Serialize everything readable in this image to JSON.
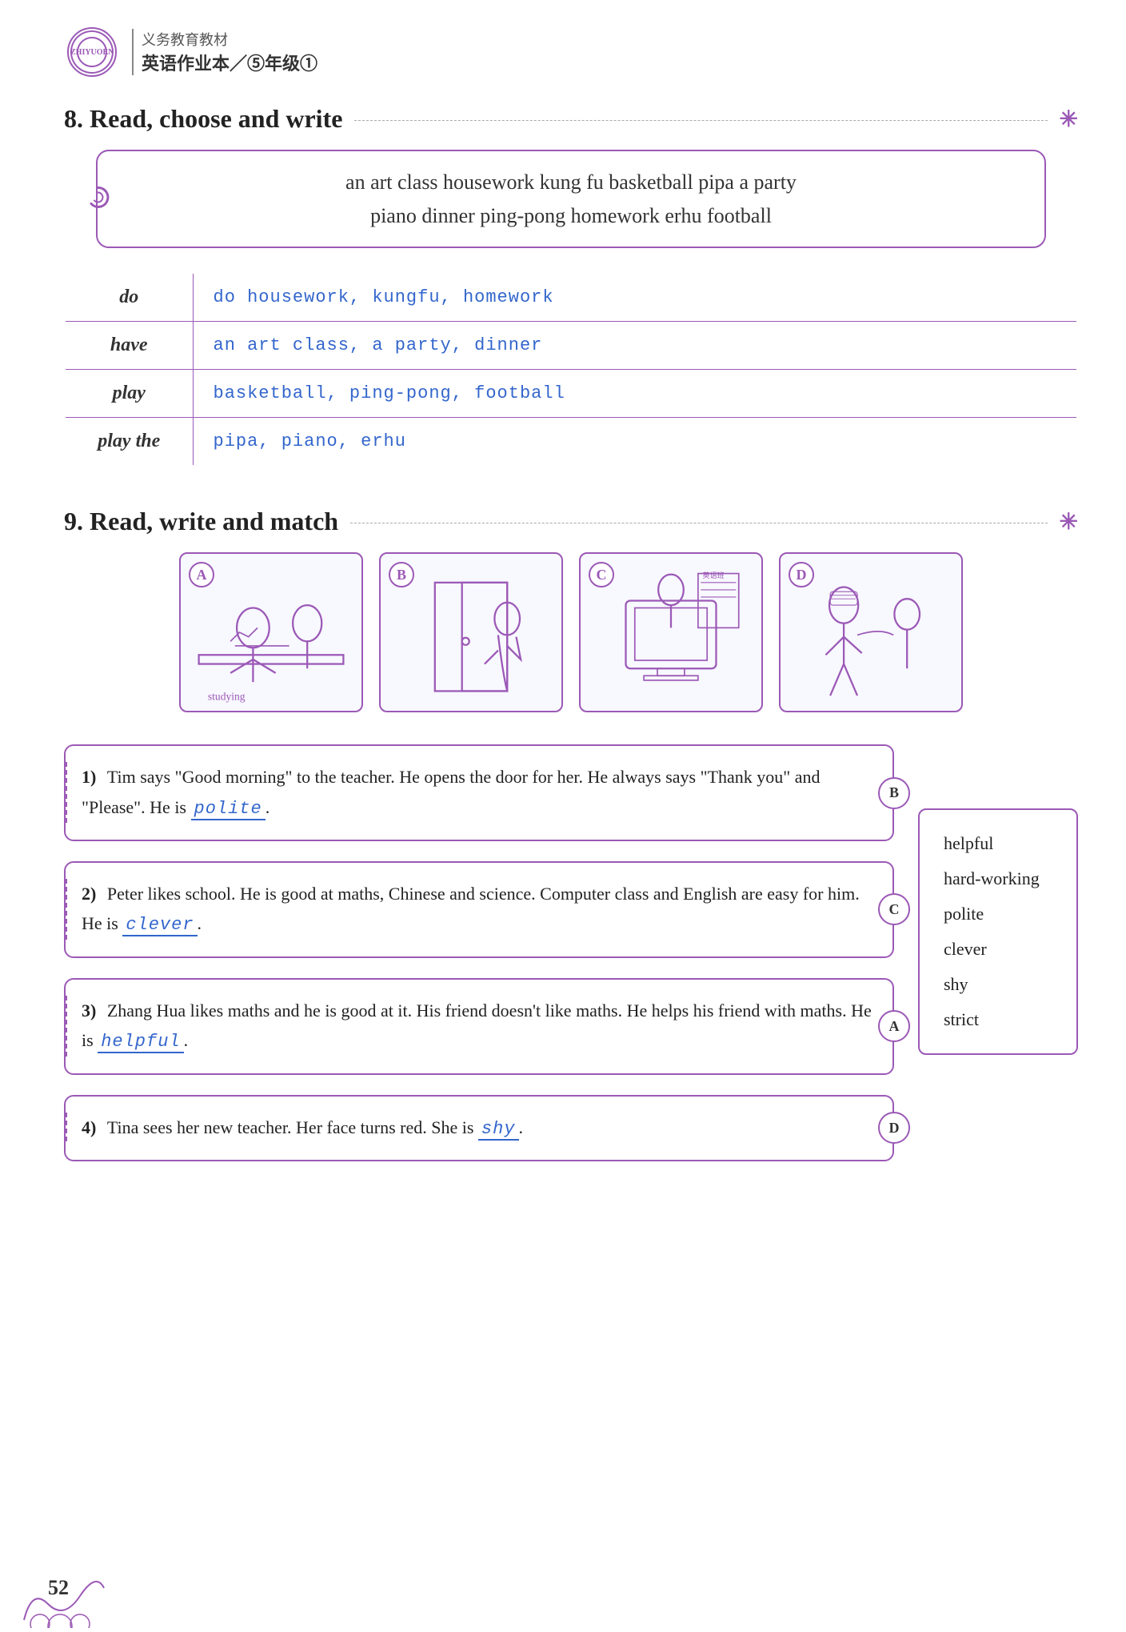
{
  "header": {
    "subtitle": "义务教育教材",
    "title": "英语作业本／⑤年级①"
  },
  "section8": {
    "heading_num": "8.",
    "heading_text": "Read, choose and write",
    "word_bank_line1": "an art class   housework   kung fu   basketball   pipa   a party",
    "word_bank_line2": "piano   dinner   ping-pong   homework   erhu   football",
    "table_rows": [
      {
        "verb": "do",
        "answers": "do housework,  kungfu,  homework"
      },
      {
        "verb": "have",
        "answers": "an art class,  a party,  dinner"
      },
      {
        "verb": "play",
        "answers": "basketball,  ping-pong,  football"
      },
      {
        "verb": "play the",
        "answers": "pipa,  piano,  erhu"
      }
    ]
  },
  "section9": {
    "heading_num": "9.",
    "heading_text": "Read, write and match",
    "images": [
      {
        "label": "A",
        "desc": "Two students studying at desk"
      },
      {
        "label": "B",
        "desc": "Girl opening door"
      },
      {
        "label": "C",
        "desc": "Student at computer with board"
      },
      {
        "label": "D",
        "desc": "Teacher talking to student"
      }
    ],
    "sentences": [
      {
        "num": "1)",
        "text_before": "Tim says \"Good morning\" to the teacher. He opens the door for her. He always says \"Thank you\" and \"Please\". He is",
        "answer": "polite",
        "text_after": ".",
        "circle_label": "B"
      },
      {
        "num": "2)",
        "text_before": "Peter likes school. He is good at maths, Chinese and science. Computer class and English are easy for him. He is",
        "answer": "clever",
        "text_after": ".",
        "circle_label": "C"
      },
      {
        "num": "3)",
        "text_before": "Zhang Hua likes maths and he is good at it. His friend doesn't like maths. He helps his friend with maths. He is",
        "answer": "helpful",
        "text_after": ".",
        "circle_label": "A"
      },
      {
        "num": "4)",
        "text_before": "Tina sees her new teacher. Her face turns red. She is",
        "answer": "shy",
        "text_after": ".",
        "circle_label": "D"
      }
    ],
    "word_list": [
      "helpful",
      "hard-working",
      "polite",
      "clever",
      "shy",
      "strict"
    ]
  },
  "footer": {
    "page_num": "52"
  }
}
